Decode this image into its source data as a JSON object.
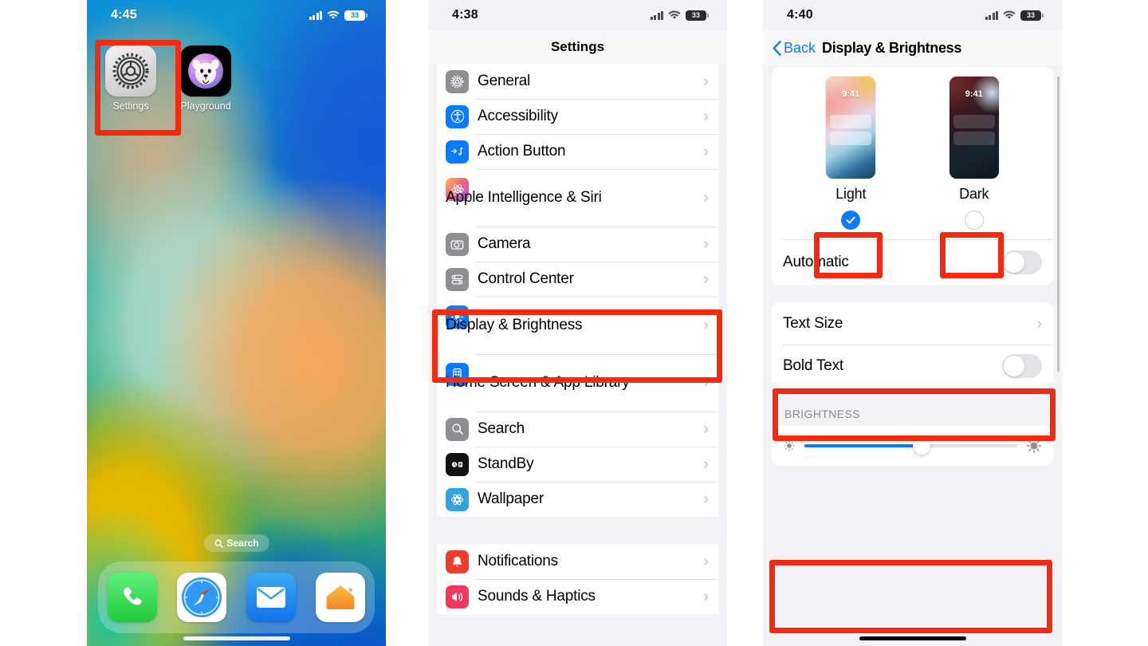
{
  "panels": {
    "home": {
      "status": {
        "time": "4:45",
        "battery": "33",
        "signal_icon": "cellular-signal-icon",
        "wifi_icon": "wifi-icon",
        "battery_icon": "battery-icon"
      },
      "apps": [
        {
          "label": "Settings",
          "icon": "settings-gear-icon"
        },
        {
          "label": "Playground",
          "icon": "image-playground-icon"
        }
      ],
      "search_pill": {
        "label": "Search",
        "icon": "search-icon"
      },
      "dock": [
        {
          "label": "Phone",
          "icon": "phone-icon"
        },
        {
          "label": "Safari",
          "icon": "safari-compass-icon"
        },
        {
          "label": "Mail",
          "icon": "mail-envelope-icon"
        },
        {
          "label": "Home",
          "icon": "home-house-icon"
        }
      ]
    },
    "settings": {
      "status": {
        "time": "4:38",
        "battery": "33"
      },
      "title": "Settings",
      "groups": [
        {
          "rows": [
            {
              "label": "General",
              "icon": "general-gear-icon",
              "color": "#8e8e93",
              "chevron": "›"
            },
            {
              "label": "Accessibility",
              "icon": "accessibility-icon",
              "color": "#0a7aff",
              "chevron": "›"
            },
            {
              "label": "Action Button",
              "icon": "action-button-icon",
              "color": "#0a7aff",
              "chevron": "›"
            },
            {
              "label": "Apple Intelligence & Siri",
              "icon": "apple-intelligence-icon",
              "color": "#f05c8a",
              "chevron": "›",
              "wrap": true
            },
            {
              "label": "Camera",
              "icon": "camera-icon",
              "color": "#8e8e93",
              "chevron": "›"
            },
            {
              "label": "Control Center",
              "icon": "control-center-icon",
              "color": "#8e8e93",
              "chevron": "›"
            },
            {
              "label": "Display & Brightness",
              "icon": "display-brightness-icon",
              "color": "#0a7aff",
              "chevron": "›",
              "wrap": true,
              "highlighted": true
            },
            {
              "label": "Home Screen & App Library",
              "icon": "home-screen-icon",
              "color": "#0a7aff",
              "chevron": "›",
              "wrap": true
            },
            {
              "label": "Search",
              "icon": "search-gray-icon",
              "color": "#8e8e93",
              "chevron": "›"
            },
            {
              "label": "StandBy",
              "icon": "standby-icon",
              "color": "#111113",
              "chevron": "›"
            },
            {
              "label": "Wallpaper",
              "icon": "wallpaper-icon",
              "color": "#2fa5e0",
              "chevron": "›"
            }
          ]
        },
        {
          "rows": [
            {
              "label": "Notifications",
              "icon": "notifications-bell-icon",
              "color": "#f03b2f",
              "chevron": "›"
            },
            {
              "label": "Sounds & Haptics",
              "icon": "sounds-haptics-icon",
              "color": "#f0395c",
              "chevron": "›"
            }
          ]
        }
      ]
    },
    "display": {
      "status": {
        "time": "4:40",
        "battery": "33"
      },
      "back_label": "Back",
      "title": "Display & Brightness",
      "appearance": {
        "themes": [
          {
            "name": "Light",
            "preview_time": "9:41",
            "selected": true
          },
          {
            "name": "Dark",
            "preview_time": "9:41",
            "selected": false
          }
        ],
        "automatic_label": "Automatic",
        "automatic_on": false
      },
      "text_rows": [
        {
          "label": "Text Size",
          "type": "link",
          "chevron": "›",
          "highlighted": true
        },
        {
          "label": "Bold Text",
          "type": "toggle",
          "on": false
        }
      ],
      "brightness": {
        "section_label": "BRIGHTNESS",
        "value_percent": 55,
        "low_icon": "brightness-low-icon",
        "high_icon": "brightness-high-icon"
      }
    }
  },
  "annotations": {
    "highlight_color": "#f42a10",
    "boxes": [
      {
        "name": "settings-app-highlight"
      },
      {
        "name": "display-brightness-row-highlight"
      },
      {
        "name": "light-theme-check-highlight"
      },
      {
        "name": "dark-theme-check-highlight"
      },
      {
        "name": "text-size-row-highlight"
      },
      {
        "name": "brightness-section-highlight"
      }
    ]
  }
}
